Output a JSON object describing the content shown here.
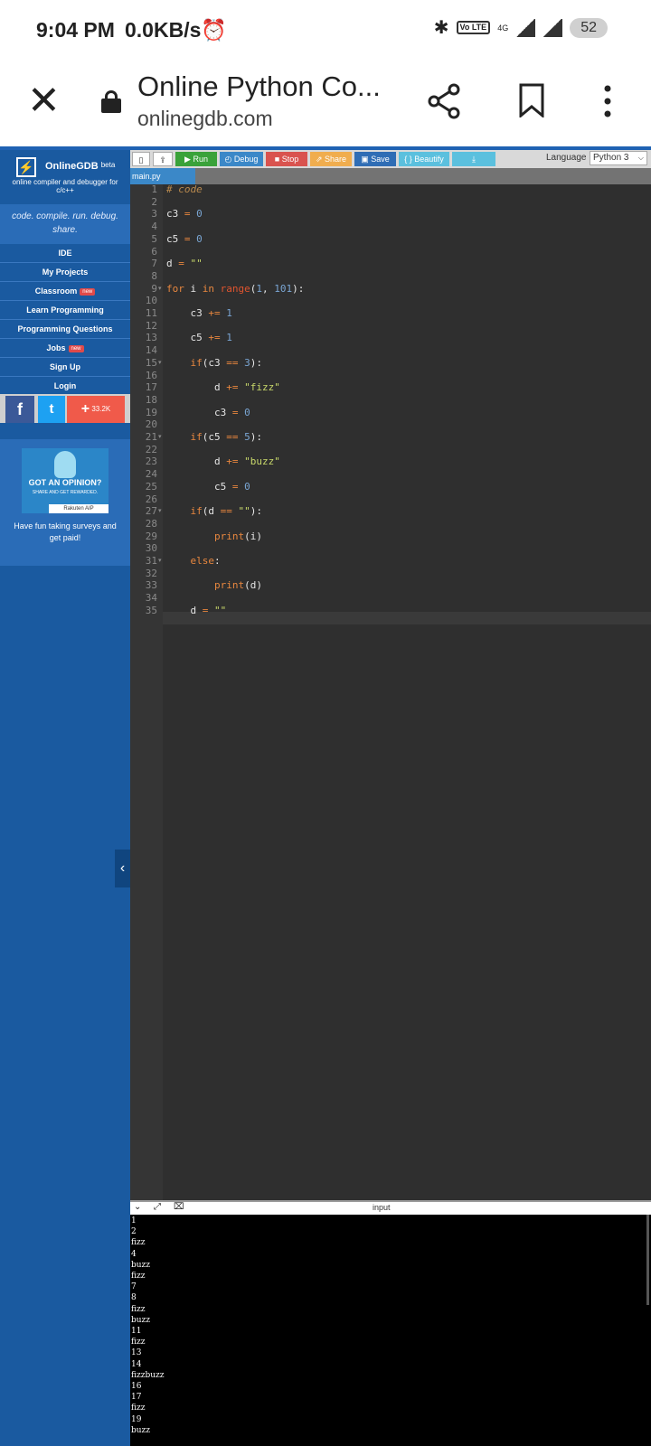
{
  "status": {
    "time": "9:04 PM",
    "speed": "0.0KB/s",
    "network": "4G",
    "volte": "Vo LTE",
    "battery": "52"
  },
  "browser": {
    "title": "Online Python Co...",
    "url": "onlinegdb.com"
  },
  "sidebar": {
    "brand": "OnlineGDB",
    "beta": "beta",
    "tagline": "online compiler and debugger for c/c++",
    "motto": "code. compile. run. debug. share.",
    "nav": [
      {
        "label": "IDE",
        "badge": ""
      },
      {
        "label": "My Projects",
        "badge": ""
      },
      {
        "label": "Classroom",
        "badge": "new"
      },
      {
        "label": "Learn Programming",
        "badge": ""
      },
      {
        "label": "Programming Questions",
        "badge": ""
      },
      {
        "label": "Jobs",
        "badge": "new"
      },
      {
        "label": "Sign Up",
        "badge": ""
      },
      {
        "label": "Login",
        "badge": ""
      }
    ],
    "social_count": "33.2K",
    "ad": {
      "headline": "GOT AN OPINION?",
      "subline": "SHARE AND GET REWARDED.",
      "brand": "Rakuten AIP",
      "caption": "Have fun taking surveys and get paid!"
    }
  },
  "toolbar": {
    "run": "Run",
    "debug": "Debug",
    "stop": "Stop",
    "share": "Share",
    "save": "Save",
    "beautify": "{ } Beautify",
    "language_label": "Language",
    "language_value": "Python 3",
    "colors": {
      "run": "#3aa23a",
      "debug": "#3b88c8",
      "stop": "#d9534f",
      "share": "#f0ad4e",
      "save": "#2f6db5",
      "beautify": "#5bc0de",
      "download": "#5bc0de"
    }
  },
  "file_tab": "main.py",
  "code_lines": [
    "# code",
    "",
    "c3 = 0",
    "",
    "c5 = 0",
    "",
    "d = \"\"",
    "",
    "for i in range(1, 101):",
    "",
    "    c3 += 1",
    "",
    "    c5 += 1",
    "",
    "    if(c3 == 3):",
    "",
    "        d += \"fizz\"",
    "",
    "        c3 = 0",
    "",
    "    if(c5 == 5):",
    "",
    "        d += \"buzz\"",
    "",
    "        c5 = 0",
    "",
    "    if(d == \"\"):",
    "",
    "        print(i)",
    "",
    "    else:",
    "",
    "        print(d)",
    "",
    "    d = \"\""
  ],
  "output_label": "input",
  "output_lines": [
    "1",
    "2",
    "fizz",
    "4",
    "buzz",
    "fizz",
    "7",
    "8",
    "fizz",
    "buzz",
    "11",
    "fizz",
    "13",
    "14",
    "fizzbuzz",
    "16",
    "17",
    "fizz",
    "19",
    "buzz"
  ]
}
